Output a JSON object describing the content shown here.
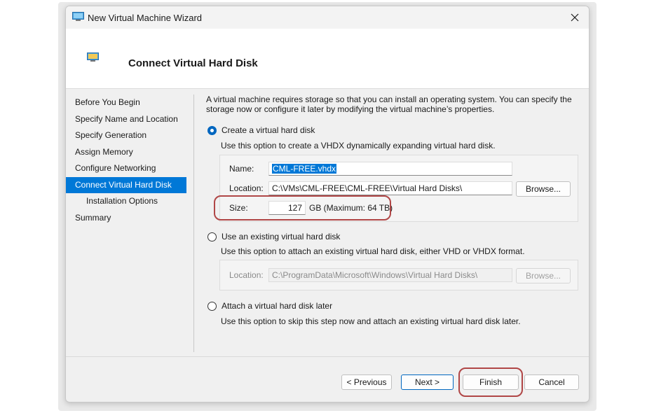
{
  "window": {
    "title": "New Virtual Machine Wizard"
  },
  "header": {
    "title": "Connect Virtual Hard Disk"
  },
  "nav": {
    "items": [
      {
        "label": "Before You Begin"
      },
      {
        "label": "Specify Name and Location"
      },
      {
        "label": "Specify Generation"
      },
      {
        "label": "Assign Memory"
      },
      {
        "label": "Configure Networking"
      },
      {
        "label": "Connect Virtual Hard Disk"
      },
      {
        "label": "Installation Options"
      },
      {
        "label": "Summary"
      }
    ]
  },
  "content": {
    "intro": "A virtual machine requires storage so that you can install an operating system. You can specify the storage now or configure it later by modifying the virtual machine’s properties.",
    "option_create": {
      "label": "Create a virtual hard disk",
      "desc": "Use this option to create a VHDX dynamically expanding virtual hard disk.",
      "name_label": "Name:",
      "name_value": "CML-FREE.vhdx",
      "location_label": "Location:",
      "location_value": "C:\\VMs\\CML-FREE\\CML-FREE\\Virtual Hard Disks\\",
      "browse_label": "Browse...",
      "size_label": "Size:",
      "size_value": "127",
      "size_unit": "GB (Maximum: 64 TB)"
    },
    "option_existing": {
      "label": "Use an existing virtual hard disk",
      "desc": "Use this option to attach an existing virtual hard disk, either VHD or VHDX format.",
      "location_label": "Location:",
      "location_value": "C:\\ProgramData\\Microsoft\\Windows\\Virtual Hard Disks\\",
      "browse_label": "Browse..."
    },
    "option_later": {
      "label": "Attach a virtual hard disk later",
      "desc": "Use this option to skip this step now and attach an existing virtual hard disk later."
    }
  },
  "buttons": {
    "previous": "< Previous",
    "next": "Next >",
    "finish": "Finish",
    "cancel": "Cancel"
  },
  "colors": {
    "accent": "#0078d7",
    "highlight": "#b04646"
  }
}
